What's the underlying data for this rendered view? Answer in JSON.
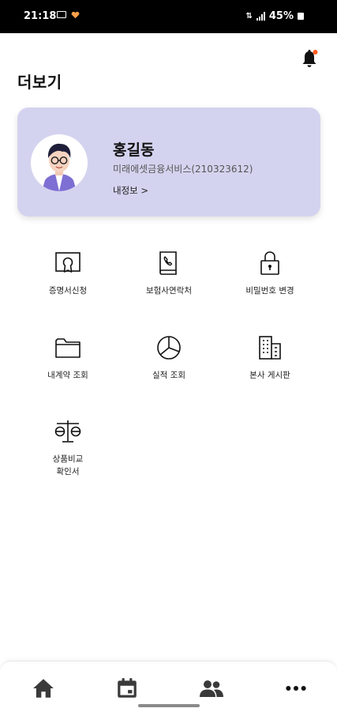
{
  "status_bar": {
    "time": "21:18",
    "battery": "45%"
  },
  "page": {
    "title": "더보기"
  },
  "profile": {
    "name": "홍길동",
    "company": "미래에셋금융서비스(210323612)",
    "info_link": "내정보 >"
  },
  "menu": [
    {
      "label": "증명서신청",
      "icon": "certificate-icon"
    },
    {
      "label": "보험사연락처",
      "icon": "phone-book-icon"
    },
    {
      "label": "비밀번호 변경",
      "icon": "lock-icon"
    },
    {
      "label": "내계약 조회",
      "icon": "folder-icon"
    },
    {
      "label": "실적 조회",
      "icon": "pie-chart-icon"
    },
    {
      "label": "본사 게시판",
      "icon": "building-icon"
    },
    {
      "label": "상품비교\n확인서",
      "icon": "scale-icon"
    }
  ],
  "bottom_nav": [
    "home-icon",
    "calendar-icon",
    "people-icon",
    "more-icon"
  ],
  "colors": {
    "card_bg": "#d4d3ef",
    "notification_dot": "#ff5a1f",
    "avatar_shirt": "#7d6fd3"
  }
}
